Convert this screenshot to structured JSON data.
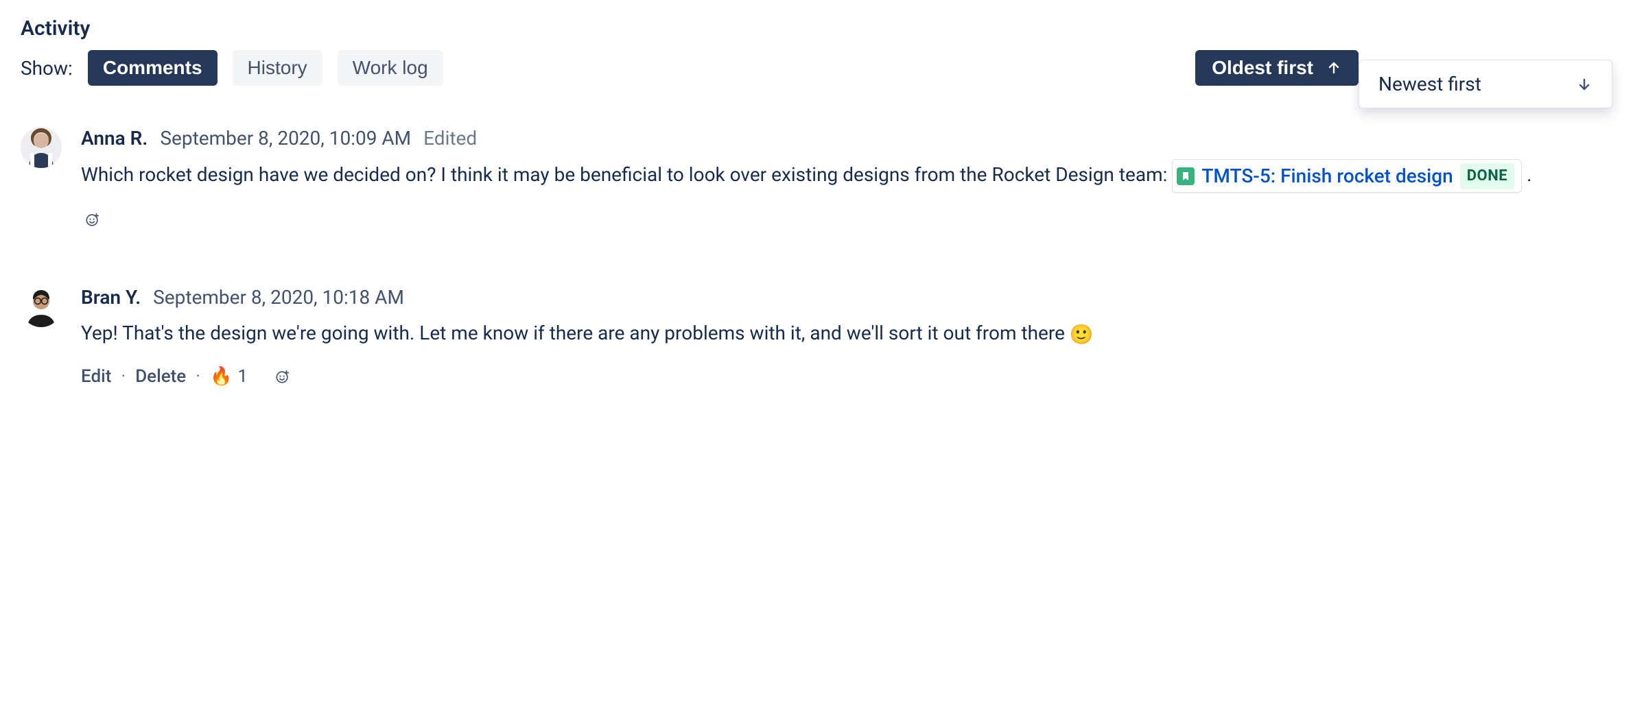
{
  "section_title": "Activity",
  "filter": {
    "show_label": "Show:",
    "tabs": [
      {
        "label": "Comments",
        "active": true
      },
      {
        "label": "History",
        "active": false
      },
      {
        "label": "Work log",
        "active": false
      }
    ]
  },
  "sort": {
    "selected_label": "Oldest first",
    "dropdown_option_label": "Newest first"
  },
  "comments": [
    {
      "author": "Anna R.",
      "timestamp": "September 8, 2020, 10:09 AM",
      "edited_label": "Edited",
      "text_before": "Which rocket design have we decided on? I think it may be beneficial to look over existing designs from the Rocket Design team: ",
      "issue_ref": {
        "key_and_title": "TMTS-5: Finish rocket design",
        "status": "DONE"
      },
      "text_after": "."
    },
    {
      "author": "Bran Y.",
      "timestamp": "September 8, 2020, 10:18 AM",
      "text_before": "Yep! That's the design we're going with. Let me know if there are any problems with it, and we'll sort it out from there ",
      "inline_emoji": "🙂",
      "actions": {
        "edit": "Edit",
        "delete": "Delete",
        "reaction_emoji": "🔥",
        "reaction_count": "1"
      }
    }
  ]
}
